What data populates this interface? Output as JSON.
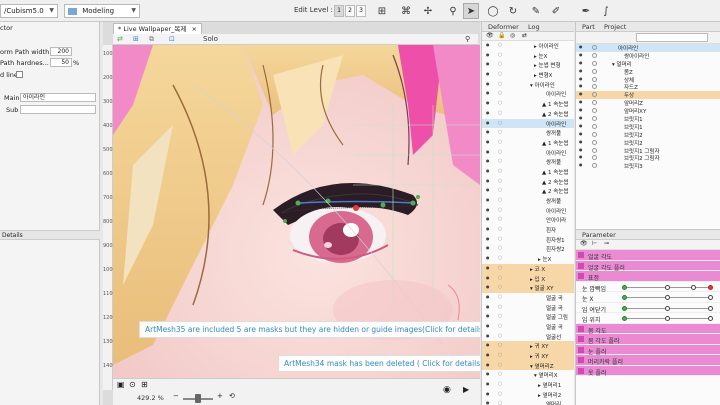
{
  "topbar": {
    "path_combo": "/Cubism5.0",
    "mode_combo": "Modeling",
    "edit_level_label": "Edit Level :",
    "edit_levels": [
      "1",
      "2",
      "3"
    ]
  },
  "left": {
    "section": "ctor",
    "form_path_width_label": "orm Path width",
    "form_path_width_value": "200",
    "path_hardness_label": "Path hardnes...",
    "path_hardness_value": "50",
    "path_hardness_unit": "%",
    "lines_label": "d line",
    "main_label": "Main",
    "main_value": "아이라인",
    "sub_label": "Sub",
    "details_tab": "Details"
  },
  "canvas": {
    "doc_tab": "* Live Wallpaper_복제",
    "solo": "Solo",
    "ruler": [
      "100",
      "200",
      "300",
      "400",
      "500",
      "600",
      "700",
      "800",
      "900",
      "1000",
      "1100",
      "1200",
      "1300",
      "1400"
    ],
    "notice1": "ArtMesh35 are included 5 are masks but they are hidden or guide images(Click for details)",
    "notice2": "ArtMesh34 mask has been deleted ( Click for details )",
    "zoom": "429.2 %"
  },
  "deformer": {
    "tabs": [
      "Deformer",
      "Log"
    ],
    "rows": [
      {
        "label": "▸ 아이라인",
        "indent": 40,
        "hl": false,
        "sel": false
      },
      {
        "label": "▸ 눈X",
        "indent": 40,
        "hl": false,
        "sel": false
      },
      {
        "label": "▸ 눈썹 변형",
        "indent": 40,
        "hl": false,
        "sel": false
      },
      {
        "label": "▸ 변형X",
        "indent": 40,
        "hl": false,
        "sel": false
      },
      {
        "label": "▾ 아이라인",
        "indent": 36,
        "hl": false,
        "sel": false
      },
      {
        "label": "아이라인",
        "indent": 52,
        "hl": false,
        "sel": false
      },
      {
        "label": "▲ 1 속눈썹",
        "indent": 48,
        "hl": false,
        "sel": false
      },
      {
        "label": "▲ 2 속눈썹",
        "indent": 48,
        "hl": false,
        "sel": false
      },
      {
        "label": "아이라인",
        "indent": 52,
        "hl": false,
        "sel": true
      },
      {
        "label": "쌍꺼풀",
        "indent": 52,
        "hl": false,
        "sel": false
      },
      {
        "label": "▲ 1 속눈썹",
        "indent": 48,
        "hl": false,
        "sel": false
      },
      {
        "label": "아이라인",
        "indent": 52,
        "hl": false,
        "sel": false
      },
      {
        "label": "쌍꺼풀",
        "indent": 52,
        "hl": false,
        "sel": false
      },
      {
        "label": "▲ 1 속눈썹",
        "indent": 48,
        "hl": false,
        "sel": false
      },
      {
        "label": "▲ 2 속눈썹",
        "indent": 48,
        "hl": false,
        "sel": false
      },
      {
        "label": "▲ 2 속눈썹",
        "indent": 48,
        "hl": false,
        "sel": false
      },
      {
        "label": "쌍꺼풀",
        "indent": 52,
        "hl": false,
        "sel": false
      },
      {
        "label": "아이라인",
        "indent": 52,
        "hl": false,
        "sel": false
      },
      {
        "label": "안아이라",
        "indent": 52,
        "hl": false,
        "sel": false
      },
      {
        "label": "흰자",
        "indent": 52,
        "hl": false,
        "sel": false
      },
      {
        "label": "흰자쌍1",
        "indent": 52,
        "hl": false,
        "sel": false
      },
      {
        "label": "흰자쌍2",
        "indent": 52,
        "hl": false,
        "sel": false
      },
      {
        "label": "▸ 눈X",
        "indent": 44,
        "hl": false,
        "sel": false
      },
      {
        "label": "▸ 코 X",
        "indent": 36,
        "hl": true,
        "sel": false
      },
      {
        "label": "▸ 입 X",
        "indent": 36,
        "hl": true,
        "sel": false
      },
      {
        "label": "▾ 얼굴 XY",
        "indent": 36,
        "hl": true,
        "sel": false
      },
      {
        "label": "얼굴 곡",
        "indent": 52,
        "hl": false,
        "sel": false
      },
      {
        "label": "얼굴 곡",
        "indent": 52,
        "hl": false,
        "sel": false
      },
      {
        "label": "얼굴 그림",
        "indent": 52,
        "hl": false,
        "sel": false
      },
      {
        "label": "얼굴 곡",
        "indent": 52,
        "hl": false,
        "sel": false
      },
      {
        "label": "얼굴선",
        "indent": 52,
        "hl": false,
        "sel": false
      },
      {
        "label": "▸ 귀 XY",
        "indent": 36,
        "hl": true,
        "sel": false
      },
      {
        "label": "▸ 귀 XY",
        "indent": 36,
        "hl": true,
        "sel": false
      },
      {
        "label": "▾ 옆머리Z",
        "indent": 36,
        "hl": true,
        "sel": false
      },
      {
        "label": "▾ 옆머리X",
        "indent": 40,
        "hl": false,
        "sel": false
      },
      {
        "label": "▸ 옆머리1",
        "indent": 44,
        "hl": false,
        "sel": false
      },
      {
        "label": "▸ 옆머리2",
        "indent": 44,
        "hl": false,
        "sel": false
      },
      {
        "label": "옆머리",
        "indent": 52,
        "hl": false,
        "sel": false
      }
    ]
  },
  "part": {
    "tabs": [
      "Part",
      "Project"
    ],
    "rows": [
      {
        "label": "아이라인",
        "indent": 42,
        "hl": false,
        "sel": true
      },
      {
        "label": "쌍아이라인",
        "indent": 48,
        "hl": false,
        "sel": false
      },
      {
        "label": "▾ 얼머리",
        "indent": 36,
        "hl": false,
        "sel": false
      },
      {
        "label": "몸Z",
        "indent": 48,
        "hl": false,
        "sel": false
      },
      {
        "label": "상체",
        "indent": 48,
        "hl": false,
        "sel": false
      },
      {
        "label": "자드Z",
        "indent": 48,
        "hl": false,
        "sel": false
      },
      {
        "label": "두상",
        "indent": 48,
        "hl": true,
        "sel": false
      },
      {
        "label": "앞머리Z",
        "indent": 48,
        "hl": false,
        "sel": false
      },
      {
        "label": "앞머리XY",
        "indent": 48,
        "hl": false,
        "sel": false
      },
      {
        "label": "브릿지1",
        "indent": 48,
        "hl": false,
        "sel": false
      },
      {
        "label": "브릿지1",
        "indent": 48,
        "hl": false,
        "sel": false
      },
      {
        "label": "브릿지2",
        "indent": 48,
        "hl": false,
        "sel": false
      },
      {
        "label": "브릿지2",
        "indent": 48,
        "hl": false,
        "sel": false
      },
      {
        "label": "브릿지1 그림자",
        "indent": 48,
        "hl": false,
        "sel": false
      },
      {
        "label": "브릿지2 그림자",
        "indent": 48,
        "hl": false,
        "sel": false
      },
      {
        "label": "브릿지3",
        "indent": 48,
        "hl": false,
        "sel": false
      }
    ]
  },
  "parameter": {
    "title": "Parameter",
    "rows": [
      {
        "label": "얼굴 각도",
        "group": true
      },
      {
        "label": "얼굴 각도 플러",
        "group": true
      },
      {
        "label": "표정",
        "group": true
      },
      {
        "label": "눈 깜빡임",
        "group": false,
        "dots": [
          0.0,
          0.5,
          0.8,
          1.0
        ]
      },
      {
        "label": "눈 X",
        "group": false,
        "dots": [
          0.0,
          0.5,
          1.0
        ]
      },
      {
        "label": "입 여닫기",
        "group": false,
        "dots": [
          0.0,
          0.5,
          1.0
        ]
      },
      {
        "label": "입 위치",
        "group": false,
        "dots": [
          0.0,
          0.5,
          1.0
        ]
      },
      {
        "label": "몸 각도",
        "group": true
      },
      {
        "label": "몸 각도 플러",
        "group": true
      },
      {
        "label": "눈 플러",
        "group": true
      },
      {
        "label": "머리카락 플러",
        "group": true
      },
      {
        "label": "옷 플러",
        "group": true
      }
    ]
  }
}
